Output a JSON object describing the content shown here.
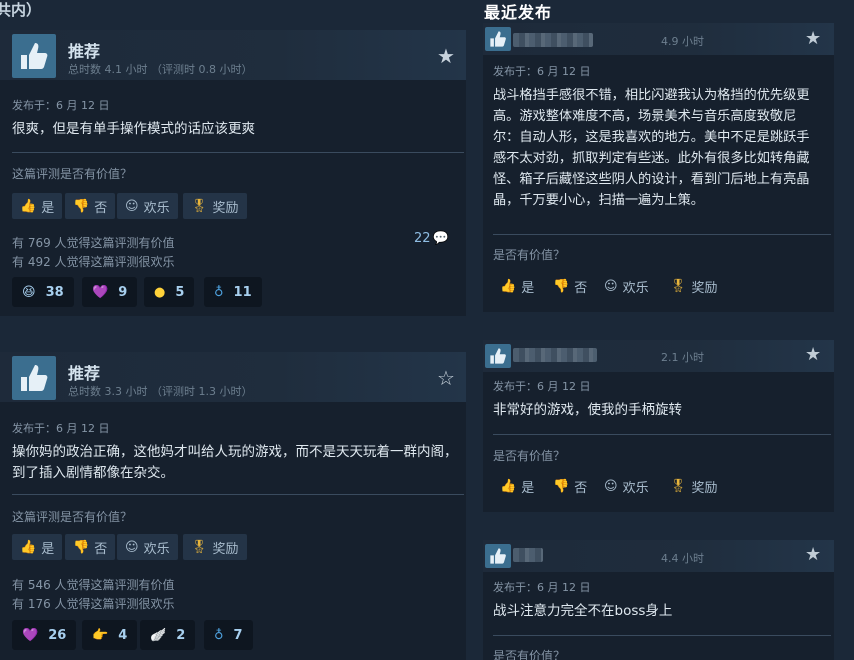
{
  "top_fragment": "共内）",
  "right_section_title": "最近发布",
  "left_reviews": [
    {
      "label": "推荐",
      "hours": "总时数 4.1 小时 （评测时 0.8 小时）",
      "posted": "发布于：6 月 12 日",
      "text": "很爽，但是有单手操作模式的话应该更爽",
      "helpful_question": "这篇评测是否有价值？",
      "buttons": {
        "yes": "是",
        "no": "否",
        "funny": "欢乐",
        "award": "奖励"
      },
      "helpful_count": "有 769 人觉得这篇评测有价值",
      "funny_count": "有 492 人觉得这篇评测很欢乐",
      "comments": "22",
      "awards": [
        {
          "icon": "laughing-face-icon",
          "count": "38"
        },
        {
          "icon": "heart-hands-icon",
          "count": "9"
        },
        {
          "icon": "sunny-icon",
          "count": "5"
        },
        {
          "icon": "ribbon-icon",
          "count": "11"
        }
      ]
    },
    {
      "label": "推荐",
      "hours": "总时数 3.3 小时 （评测时 1.3 小时）",
      "posted": "发布于：6 月 12 日",
      "text": "操你妈的政治正确，这他妈才叫给人玩的游戏，而不是天天玩着一群内阁，到了插入剧情都像在杂交。",
      "helpful_question": "这篇评测是否有价值？",
      "buttons": {
        "yes": "是",
        "no": "否",
        "funny": "欢乐",
        "award": "奖励"
      },
      "helpful_count": "有 546 人觉得这篇评测有价值",
      "funny_count": "有 176 人觉得这篇评测很欢乐",
      "awards": [
        {
          "icon": "heart-hands-icon",
          "count": "26"
        },
        {
          "icon": "pointing-hand-icon",
          "count": "4"
        },
        {
          "icon": "winged-icon",
          "count": "2"
        },
        {
          "icon": "ribbon-icon",
          "count": "7"
        }
      ]
    }
  ],
  "right_reviews": [
    {
      "hours": "4.9 小时",
      "posted": "发布于：6 月 12 日",
      "text": "战斗格挡手感很不错，相比闪避我认为格挡的优先级更高。游戏整体难度不高，场景美术与音乐高度致敬尼尔：自动人形，这是我喜欢的地方。美中不足是跳跃手感不太对劲，抓取判定有些迷。此外有很多比如转角藏怪、箱子后藏怪这些阴人的设计，看到门后地上有亮晶晶，千万要小心，扫描一遍为上策。",
      "helpful_question": "是否有价值？",
      "buttons": {
        "yes": "是",
        "no": "否",
        "funny": "欢乐",
        "award": "奖励"
      }
    },
    {
      "hours": "2.1 小时",
      "posted": "发布于：6 月 12 日",
      "text": "非常好的游戏，使我的手柄旋转",
      "helpful_question": "是否有价值？",
      "buttons": {
        "yes": "是",
        "no": "否",
        "funny": "欢乐",
        "award": "奖励"
      }
    },
    {
      "hours": "4.4 小时",
      "posted": "发布于：6 月 12 日",
      "text": "战斗注意力完全不在boss身上",
      "helpful_question": "是否有价值？"
    }
  ],
  "colors": {
    "background": "#1b2838",
    "card": "#16202d",
    "accent": "#66c0f4",
    "award_gold": "#e8b53c"
  }
}
